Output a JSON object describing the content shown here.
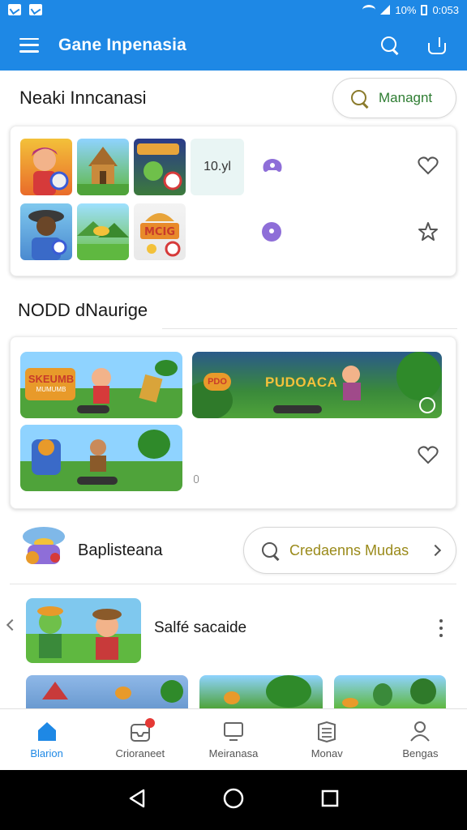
{
  "status_bar": {
    "battery": "10%",
    "time": "0:053"
  },
  "app_bar": {
    "title": "Gane Inpenasia"
  },
  "section1": {
    "title": "Neaki Inncanasi",
    "button_label": "Managnt"
  },
  "grid": {
    "badge_text": "10.yl"
  },
  "section2": {
    "title": "NODD dNaurige"
  },
  "banners": {
    "banner1_text": "SKEUMB",
    "banner1_sub": "MUMUMB",
    "banner2_text": "PUDOACA",
    "banner2_badge": "PDO"
  },
  "row3": {
    "label": "Baplisteana",
    "search_label": "Credaenns Mudas"
  },
  "row4": {
    "label": "Salfé sacaide"
  },
  "bottom_nav": [
    {
      "label": "Blarion",
      "icon": "home-icon",
      "active": true
    },
    {
      "label": "Crioraneet",
      "icon": "inbox-icon",
      "badge": true
    },
    {
      "label": "Meiranasa",
      "icon": "monitor-icon"
    },
    {
      "label": "Monav",
      "icon": "book-icon"
    },
    {
      "label": "Bengas",
      "icon": "profile-icon"
    }
  ],
  "colors": {
    "primary": "#1e88e5",
    "accent_yellow": "#8b7b2c",
    "accent_green": "#2e7d32",
    "purple": "#8e6ed8"
  }
}
